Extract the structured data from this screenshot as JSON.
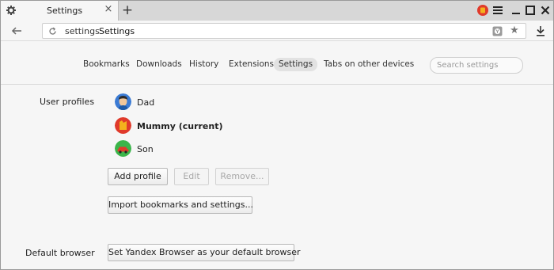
{
  "tab": {
    "title": "Settings",
    "close": "×"
  },
  "newtab": "+",
  "address": {
    "prefix": "settings",
    "title": "Settings"
  },
  "nav": {
    "items": [
      {
        "label": "Bookmarks"
      },
      {
        "label": "Downloads"
      },
      {
        "label": "History"
      },
      {
        "label": "Extensions"
      },
      {
        "label": "Settings",
        "active": true
      },
      {
        "label": "Tabs on other devices"
      }
    ],
    "search_placeholder": "Search settings"
  },
  "profiles": {
    "label": "User profiles",
    "list": [
      {
        "name": "Dad",
        "avatar": "man-avatar-icon"
      },
      {
        "name": "Mummy (current)",
        "avatar": "woman-avatar-icon",
        "current": true
      },
      {
        "name": "Son",
        "avatar": "car-avatar-icon"
      }
    ],
    "add_label": "Add profile",
    "edit_label": "Edit",
    "remove_label": "Remove...",
    "import_label": "Import bookmarks and settings..."
  },
  "default_browser": {
    "label": "Default browser",
    "button_label": "Set Yandex Browser as your default browser"
  },
  "colors": {
    "accent": "#e2e2e2",
    "window_bg": "#f6f6f6"
  }
}
